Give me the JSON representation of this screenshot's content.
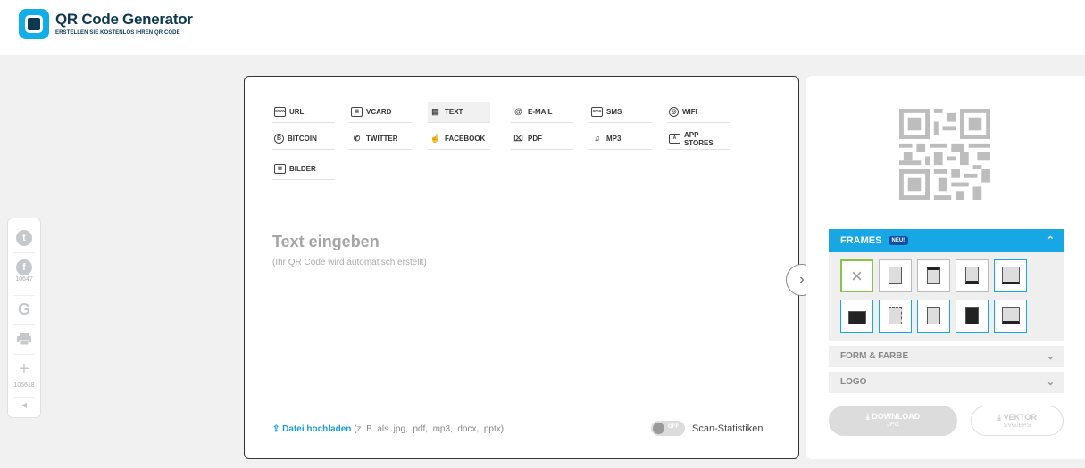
{
  "brand": {
    "title": "QR Code Generator",
    "subtitle": "ERSTELLEN SIE KOSTENLOS IHREN QR CODE"
  },
  "social": {
    "facebook_count": "10647",
    "plus_count": "105618"
  },
  "types": [
    {
      "label": "URL",
      "icon": "url-icon",
      "glyph": "www"
    },
    {
      "label": "VCARD",
      "icon": "vcard-icon",
      "glyph": "▤"
    },
    {
      "label": "TEXT",
      "icon": "text-icon",
      "glyph": "▤"
    },
    {
      "label": "E-MAIL",
      "icon": "email-icon",
      "glyph": "@"
    },
    {
      "label": "SMS",
      "icon": "sms-icon",
      "glyph": "sms"
    },
    {
      "label": "WIFI",
      "icon": "wifi-icon",
      "glyph": "◎"
    },
    {
      "label": "BITCOIN",
      "icon": "bitcoin-icon",
      "glyph": "B"
    },
    {
      "label": "TWITTER",
      "icon": "twitter-icon",
      "glyph": "✆"
    },
    {
      "label": "FACEBOOK",
      "icon": "thumbs-up-icon",
      "glyph": "☝"
    },
    {
      "label": "PDF",
      "icon": "pdf-icon",
      "glyph": "⌧"
    },
    {
      "label": "MP3",
      "icon": "music-icon",
      "glyph": "♫"
    },
    {
      "label": "APP STORES",
      "icon": "app-store-icon",
      "glyph": "A"
    },
    {
      "label": "BILDER",
      "icon": "image-icon",
      "glyph": "▨"
    }
  ],
  "active_type": "TEXT",
  "editor": {
    "heading": "Text eingeben",
    "hint": "(Ihr QR Code wird automatisch erstellt)"
  },
  "upload": {
    "link": "Datei hochladen",
    "hint": "(z. B. als .jpg, .pdf, .mp3, .docx, .pptx)"
  },
  "scan_stats": {
    "toggle_state": "OFF",
    "label": "Scan-Statistiken"
  },
  "frames": {
    "title": "FRAMES",
    "badge": "NEU!"
  },
  "form_farbe": "FORM & FARBE",
  "logo": "LOGO",
  "download": {
    "label": "DOWNLOAD",
    "format": "JPG"
  },
  "vektor": {
    "label": "VEKTOR",
    "format": "SVG/EPS"
  },
  "colors": {
    "accent": "#17a7e5",
    "brand_dark": "#0c3950",
    "selected_frame": "#8bc34a"
  }
}
